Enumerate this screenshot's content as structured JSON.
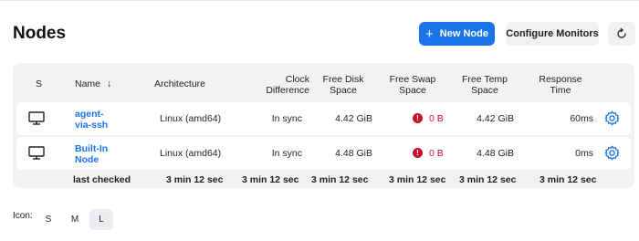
{
  "header": {
    "title": "Nodes",
    "new_node_label": "New Node",
    "configure_monitors_label": "Configure Monitors"
  },
  "table": {
    "columns": {
      "s": "S",
      "name": "Name",
      "name_sort": "↓",
      "architecture": "Architecture",
      "clock_difference": [
        "Clock",
        "Difference"
      ],
      "free_disk_space": [
        "Free Disk",
        "Space"
      ],
      "free_swap_space": [
        "Free Swap",
        "Space"
      ],
      "free_temp_space": [
        "Free Temp",
        "Space"
      ],
      "response_time": [
        "Response",
        "Time"
      ]
    },
    "rows": [
      {
        "name_lines": [
          "agent-",
          "via-ssh"
        ],
        "architecture": "Linux (amd64)",
        "clock": "In sync",
        "disk": "4.42 GiB",
        "swap": "0 B",
        "temp": "4.42 GiB",
        "response": "60ms"
      },
      {
        "name_lines": [
          "Built-In",
          "Node"
        ],
        "architecture": "Linux (amd64)",
        "clock": "In sync",
        "disk": "4.48 GiB",
        "swap": "0 B",
        "temp": "4.48 GiB",
        "response": "0ms"
      }
    ],
    "footer": {
      "label": "last checked",
      "architecture": "3 min 12 sec",
      "clock": "3 min 12 sec",
      "disk": "3 min 12 sec",
      "swap": "3 min 12 sec",
      "temp": "3 min 12 sec",
      "response": "3 min 12 sec"
    }
  },
  "icon_size": {
    "label": "Icon:",
    "options": [
      "S",
      "M",
      "L"
    ],
    "selected": "L"
  },
  "colors": {
    "accent": "#1a73e8",
    "error": "#c8102e"
  },
  "icons": {
    "new_node": "plus-icon",
    "refresh": "refresh-icon",
    "computer": "computer-icon",
    "error": "error-icon",
    "settings": "gear-icon"
  }
}
